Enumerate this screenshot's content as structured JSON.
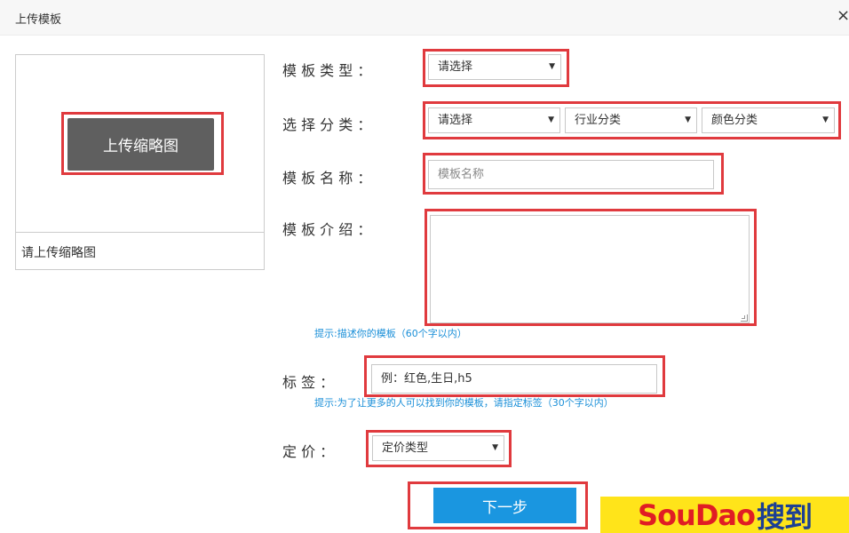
{
  "dialog": {
    "title": "上传模板",
    "close_glyph": "×"
  },
  "thumbnail": {
    "upload_button": "上传缩略图",
    "hint": "请上传缩略图"
  },
  "form": {
    "template_type": {
      "label": "模 板 类 型 ：",
      "selected": "请选择"
    },
    "category": {
      "label": "选 择 分 类 ：",
      "select1": "请选择",
      "select2": "行业分类",
      "select3": "颜色分类"
    },
    "template_name": {
      "label": "模 板 名 称 ：",
      "placeholder": "模板名称"
    },
    "template_intro": {
      "label": "模 板 介 绍 ：",
      "tip": "提示:描述你的模板（60个字以内）"
    },
    "tags": {
      "label": "标 签 ：",
      "placeholder": "例：红色,生日,h5",
      "tip": "提示:为了让更多的人可以找到你的模板，请指定标签（30个字以内）"
    },
    "price": {
      "label": "定 价 ：",
      "selected": "定价类型"
    },
    "next_button": "下一步"
  },
  "watermark": {
    "latin": "SouDao",
    "cjk": "搜到"
  },
  "colors": {
    "highlight_red": "#e03a3e",
    "button_blue": "#1a96e0",
    "tip_blue": "#1a8fd8",
    "upload_gray": "#5f5f5f"
  }
}
